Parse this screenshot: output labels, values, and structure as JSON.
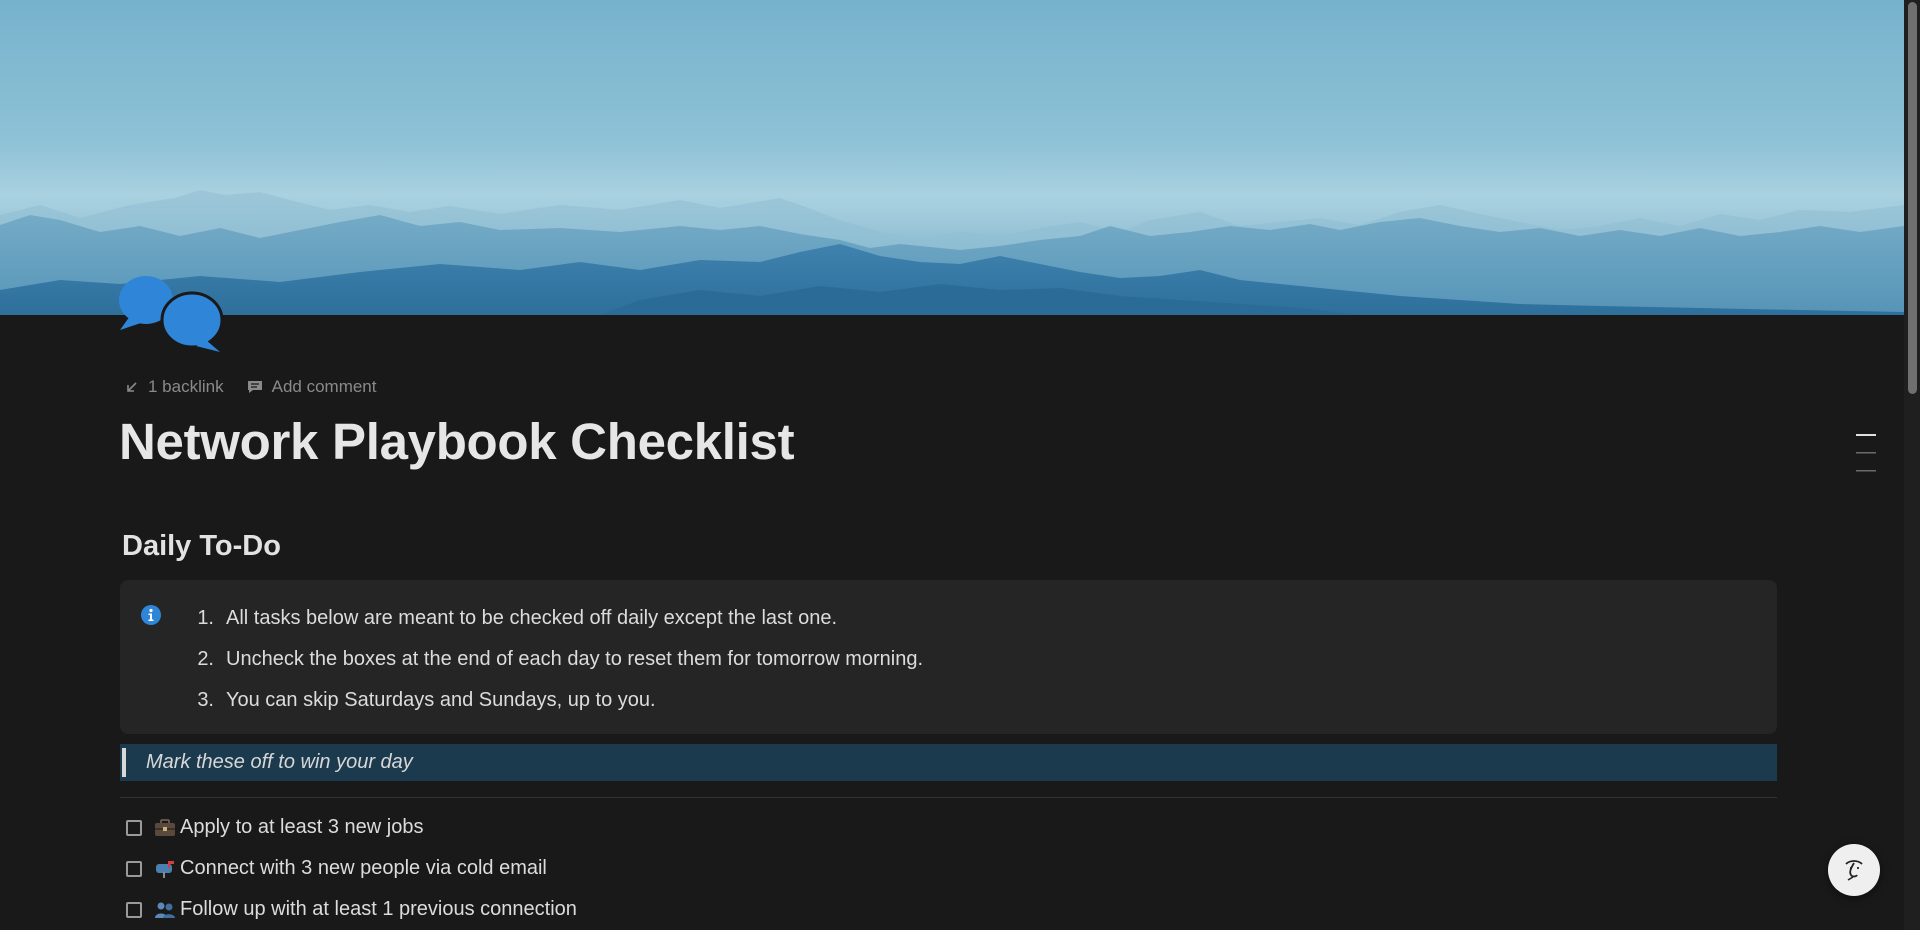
{
  "page": {
    "title": "Network Playbook Checklist",
    "icon": "speech-bubbles-icon"
  },
  "meta": {
    "backlink_label": "1 backlink",
    "comment_label": "Add comment"
  },
  "section": {
    "heading": "Daily To-Do"
  },
  "callout": {
    "icon": "info-icon",
    "items": [
      {
        "num": "1.",
        "text": "All tasks below are meant to be checked off daily except the last one."
      },
      {
        "num": "2.",
        "text": "Uncheck the boxes at the end of each day to reset them for tomorrow morning."
      },
      {
        "num": "3.",
        "text": "You can skip Saturdays and Sundays, up to you."
      }
    ]
  },
  "quote": {
    "text": "Mark these off to win your day"
  },
  "todos": [
    {
      "emoji": "briefcase-icon",
      "text": "Apply to at least 3 new jobs",
      "checked": false
    },
    {
      "emoji": "mailbox-icon",
      "text": "Connect with 3 new people via cold email",
      "checked": false
    },
    {
      "emoji": "people-icon",
      "text": "Follow up with at least 1 previous connection",
      "checked": false
    }
  ],
  "colors": {
    "background": "#191919",
    "accent_blue": "#2f86d8",
    "quote_bg": "#1b3a4e",
    "callout_bg": "#252525"
  }
}
